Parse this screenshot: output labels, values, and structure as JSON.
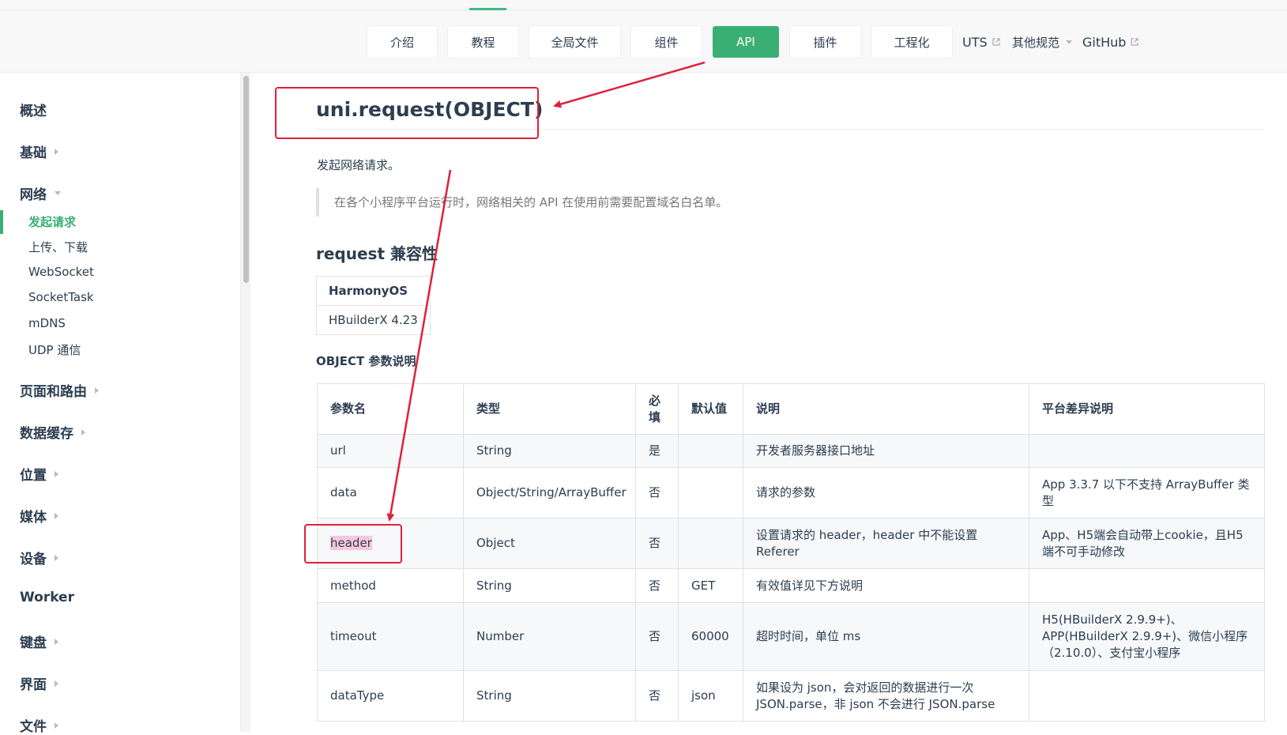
{
  "nav": {
    "items": [
      {
        "label": "介绍",
        "active": false
      },
      {
        "label": "教程",
        "active": false
      },
      {
        "label": "全局文件",
        "active": false
      },
      {
        "label": "组件",
        "active": false
      },
      {
        "label": "API",
        "active": true
      },
      {
        "label": "插件",
        "active": false
      },
      {
        "label": "工程化",
        "active": false
      }
    ],
    "links": [
      "UTS",
      "其他规范",
      "GitHub"
    ],
    "accent_color": "#3aaf73"
  },
  "sidebar": {
    "groups": [
      "概述",
      "基础",
      "网络",
      "页面和路由",
      "数据缓存",
      "位置",
      "媒体",
      "设备",
      "Worker",
      "键盘",
      "界面",
      "文件"
    ],
    "network_items": [
      "发起请求",
      "上传、下载",
      "WebSocket",
      "SocketTask",
      "mDNS",
      "UDP 通信"
    ],
    "active_item": "发起请求"
  },
  "main": {
    "title": "uni.request(OBJECT)",
    "description": "发起网络请求。",
    "note": "在各个小程序平台运行时，网络相关的 API 在使用前需要配置域名白名单。",
    "compat_heading": "request 兼容性",
    "compat_header": "HarmonyOS",
    "compat_value": "HBuilderX 4.23",
    "params_heading": "OBJECT 参数说明",
    "table": {
      "headers": [
        "参数名",
        "类型",
        "必填",
        "默认值",
        "说明",
        "平台差异说明"
      ],
      "rows": [
        [
          "url",
          "String",
          "是",
          "",
          "开发者服务器接口地址",
          ""
        ],
        [
          "data",
          "Object/String/ArrayBuffer",
          "否",
          "",
          "请求的参数",
          "App 3.3.7 以下不支持 ArrayBuffer 类型"
        ],
        [
          "header",
          "Object",
          "否",
          "",
          "设置请求的 header，header 中不能设置 Referer",
          "App、H5端会自动带上cookie，且H5端不可手动修改"
        ],
        [
          "method",
          "String",
          "否",
          "GET",
          "有效值详见下方说明",
          ""
        ],
        [
          "timeout",
          "Number",
          "否",
          "60000",
          "超时时间，单位 ms",
          "H5(HBuilderX 2.9.9+)、APP(HBuilderX 2.9.9+)、微信小程序（2.10.0）、支付宝小程序"
        ],
        [
          "dataType",
          "String",
          "否",
          "json",
          "如果设为 json，会对返回的数据进行一次 JSON.parse，非 json 不会进行 JSON.parse",
          ""
        ]
      ]
    }
  },
  "annotation_color": "#e0203a"
}
